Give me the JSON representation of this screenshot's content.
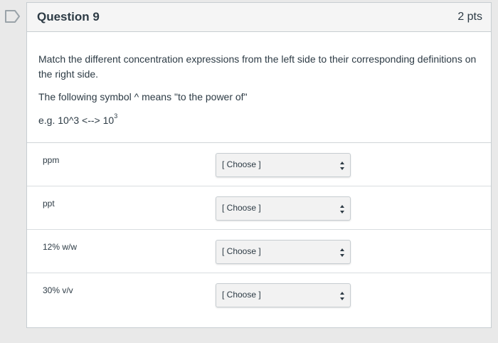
{
  "question": {
    "title": "Question 9",
    "points": "2 pts",
    "instruction": "Match the different concentration expressions from the left side to their corresponding definitions on the right side.",
    "symbol_note": "The following symbol ^ means \"to the power of\"",
    "example_prefix": "e.g. 10^3 <--> 10",
    "example_exponent": "3"
  },
  "matches": [
    {
      "label": "ppm",
      "selected": "[ Choose ]"
    },
    {
      "label": "ppt",
      "selected": "[ Choose ]"
    },
    {
      "label": "12% w/w",
      "selected": "[ Choose ]"
    },
    {
      "label": "30% v/v",
      "selected": "[ Choose ]"
    }
  ],
  "icons": {
    "flag": "bookmark-flag-icon",
    "select_arrows": "updown-arrows-icon"
  },
  "colors": {
    "text": "#2d3b45",
    "header_bg": "#f5f5f5",
    "border": "#c7cdd1",
    "select_bg": "#f2f2f2"
  }
}
